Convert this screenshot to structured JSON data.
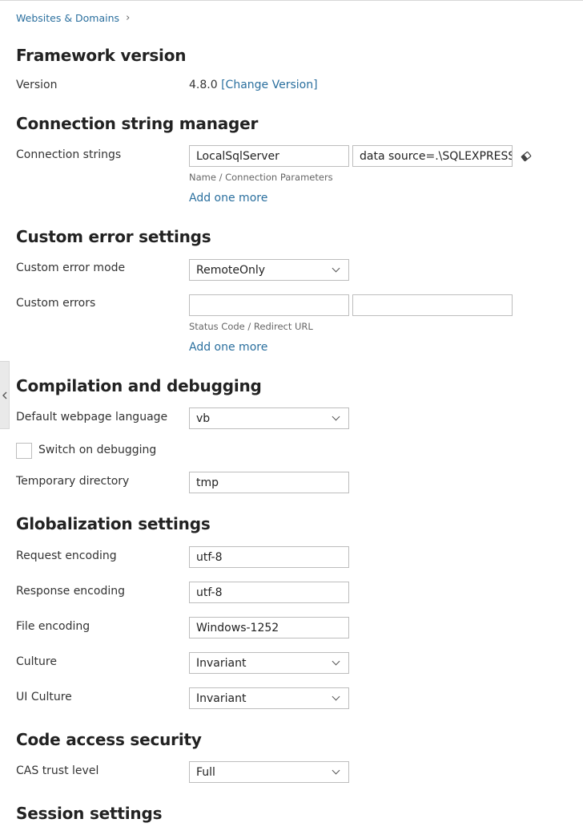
{
  "breadcrumb": {
    "label": "Websites & Domains",
    "chevron": "chevron-right-icon"
  },
  "framework": {
    "title": "Framework version",
    "version_label": "Version",
    "version_value": "4.8.0",
    "change_link": "[Change Version]"
  },
  "connection": {
    "title": "Connection string manager",
    "label": "Connection strings",
    "name_value": "LocalSqlServer",
    "params_value": "data source=.\\SQLEXPRESS;I",
    "hint": "Name / Connection Parameters",
    "add_more": "Add one more",
    "clear_icon": "eraser-icon"
  },
  "custom_errors": {
    "title": "Custom error settings",
    "mode_label": "Custom error mode",
    "mode_value": "RemoteOnly",
    "errors_label": "Custom errors",
    "status_code_value": "",
    "redirect_url_value": "",
    "hint": "Status Code / Redirect URL",
    "add_more": "Add one more"
  },
  "compilation": {
    "title": "Compilation and debugging",
    "language_label": "Default webpage language",
    "language_value": "vb",
    "debug_label": "Switch on debugging",
    "debug_checked": false,
    "tempdir_label": "Temporary directory",
    "tempdir_value": "tmp"
  },
  "globalization": {
    "title": "Globalization settings",
    "request_label": "Request encoding",
    "request_value": "utf-8",
    "response_label": "Response encoding",
    "response_value": "utf-8",
    "file_label": "File encoding",
    "file_value": "Windows-1252",
    "culture_label": "Culture",
    "culture_value": "Invariant",
    "ui_culture_label": "UI Culture",
    "ui_culture_value": "Invariant"
  },
  "cas": {
    "title": "Code access security",
    "trust_label": "CAS trust level",
    "trust_value": "Full"
  },
  "session": {
    "title": "Session settings"
  },
  "colors": {
    "link": "#2a6f9e",
    "border": "#bdbdbd",
    "text": "#222222"
  }
}
